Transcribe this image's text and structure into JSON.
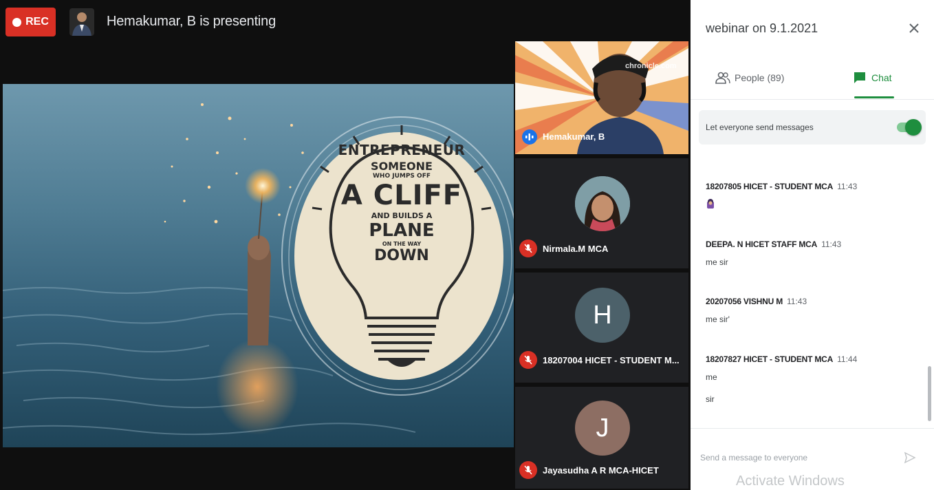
{
  "recording": {
    "label": "REC"
  },
  "presenter": {
    "banner": "Hemakumar, B is presenting"
  },
  "slide": {
    "lines": [
      "ENTREPRENEUR",
      "SOMEONE",
      "WHO JUMPS OFF",
      "A CLIFF",
      "AND BUILDS A",
      "PLANE",
      "ON THE WAY",
      "DOWN"
    ]
  },
  "tiles": {
    "main": {
      "name": "Hemakumar, B",
      "watermark": "chronicle.com"
    },
    "participants": [
      {
        "name": "Nirmala.M MCA",
        "initial": "",
        "avatar_color": "#8aa6b2"
      },
      {
        "name": "18207004 HICET - STUDENT M...",
        "initial": "H",
        "avatar_color": "#4c616a"
      },
      {
        "name": "Jayasudha A R MCA-HICET",
        "initial": "J",
        "avatar_color": "#8d6e63"
      }
    ]
  },
  "panel": {
    "title": "webinar on 9.1.2021",
    "tabs": {
      "people": "People (89)",
      "chat": "Chat"
    },
    "toggle": {
      "label": "Let everyone send messages",
      "on": true
    },
    "messages": [
      {
        "sender": "18207805 HICET - STUDENT MCA",
        "time": "11:43",
        "text": ""
      },
      {
        "sender": "DEEPA. N HICET STAFF MCA",
        "time": "11:43",
        "text": "me sir"
      },
      {
        "sender": "20207056 VISHNU M",
        "time": "11:43",
        "text": "me sir'"
      },
      {
        "sender": "18207827 HICET - STUDENT MCA",
        "time": "11:44",
        "text": "me",
        "text2": "sir"
      }
    ],
    "input": {
      "placeholder": "Send a message to everyone"
    },
    "watermark": "Activate Windows"
  },
  "colors": {
    "accent": "#1e8e3e",
    "rec": "#d93025",
    "stage": "#0f0f0f"
  }
}
